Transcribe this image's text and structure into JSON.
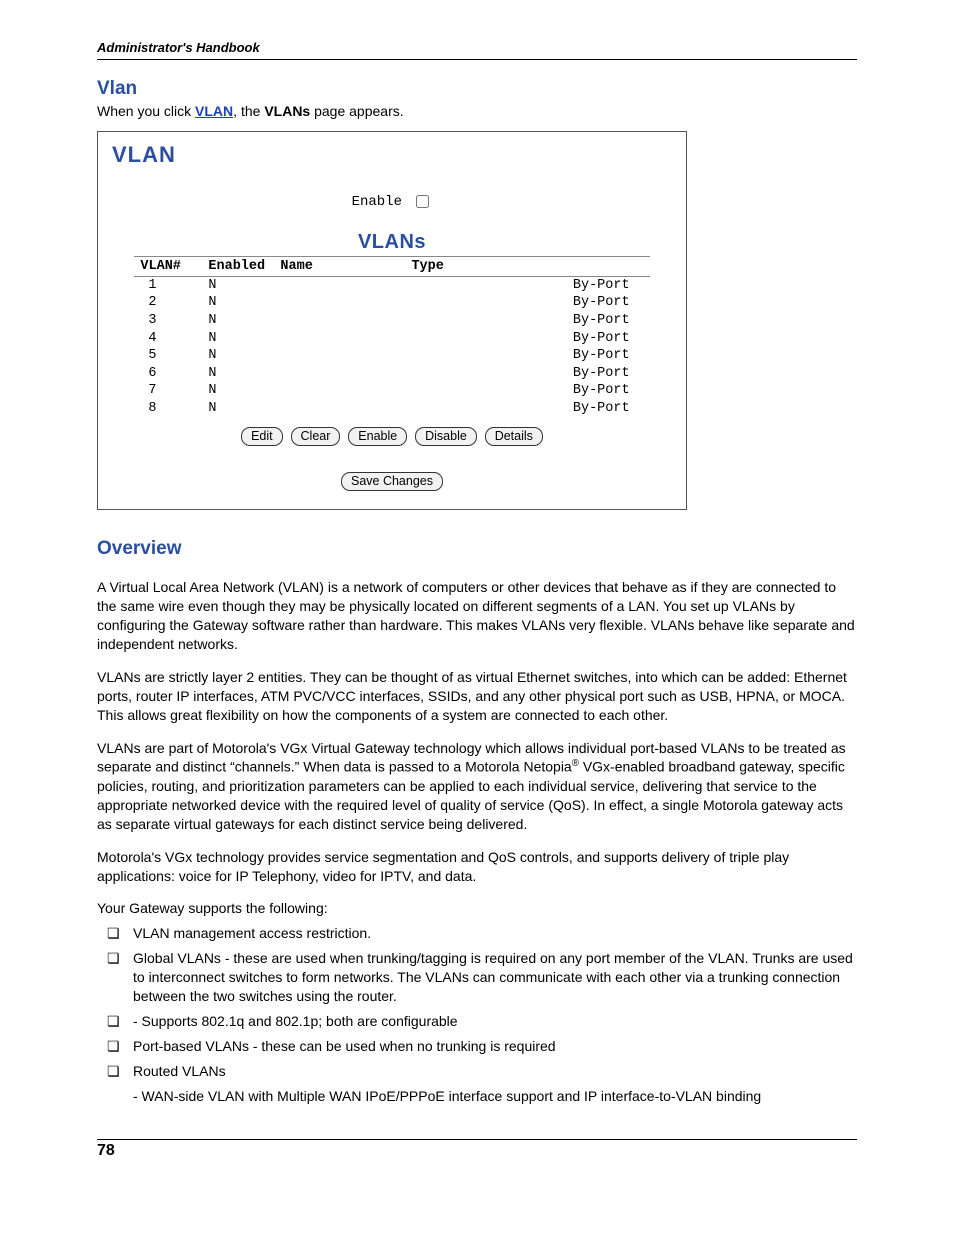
{
  "header": {
    "running": "Administrator's Handbook"
  },
  "section1": {
    "title": "Vlan",
    "intro_pre": "When you click ",
    "intro_link": "VLAN",
    "intro_mid": ", the ",
    "intro_bold": "VLANs",
    "intro_post": " page appears."
  },
  "panel": {
    "title": "VLAN",
    "enable_label": "Enable",
    "subtitle": "VLANs",
    "cols": {
      "vlan": "VLAN#",
      "enabled": "Enabled",
      "name": "Name",
      "type": "Type"
    },
    "rows": [
      {
        "n": "1",
        "en": "N",
        "name": "",
        "type": "By-Port"
      },
      {
        "n": "2",
        "en": "N",
        "name": "",
        "type": "By-Port"
      },
      {
        "n": "3",
        "en": "N",
        "name": "",
        "type": "By-Port"
      },
      {
        "n": "4",
        "en": "N",
        "name": "",
        "type": "By-Port"
      },
      {
        "n": "5",
        "en": "N",
        "name": "",
        "type": "By-Port"
      },
      {
        "n": "6",
        "en": "N",
        "name": "",
        "type": "By-Port"
      },
      {
        "n": "7",
        "en": "N",
        "name": "",
        "type": "By-Port"
      },
      {
        "n": "8",
        "en": "N",
        "name": "",
        "type": "By-Port"
      }
    ],
    "buttons": {
      "edit": "Edit",
      "clear": "Clear",
      "enable": "Enable",
      "disable": "Disable",
      "details": "Details",
      "save": "Save Changes"
    }
  },
  "overview": {
    "title": "Overview",
    "p1": "A Virtual Local Area Network (VLAN) is a network of computers or other devices that behave as if they are connected to the same wire even though they may be physically located on different segments of a LAN. You set up VLANs by configuring the Gateway software rather than hardware. This makes VLANs very flexible. VLANs behave like separate and independent networks.",
    "p2": "VLANs are strictly layer 2 entities. They can be thought of as virtual Ethernet switches, into which can be added: Ethernet ports, router IP interfaces, ATM PVC/VCC interfaces, SSIDs, and any other physical port such as USB, HPNA, or MOCA. This allows great flexibility on how the components of a system are connected to each other.",
    "p3a": "VLANs are part of Motorola's VGx Virtual Gateway technology which allows individual port-based VLANs to be treated as separate and distinct “channels.” When data is passed to a Motorola Netopia",
    "p3b": " VGx-enabled broadband gateway, specific policies, routing, and prioritization parameters can be applied to each individual service, delivering that service to the appropriate networked device with the required level of quality of service (QoS). In effect, a single Motorola gateway acts as separate virtual gateways for each distinct service being delivered.",
    "p4": "Motorola's VGx technology provides service segmentation and QoS controls, and supports delivery of triple play applications: voice for IP Telephony, video for IPTV, and data.",
    "p5": "Your Gateway supports the following:",
    "bullets": [
      "VLAN management access restriction.",
      "Global VLANs - these are used when trunking/tagging is required on any port member of the VLAN. Trunks are used to interconnect switches to form networks. The VLANs can communicate with each other via a trunking connection between the two switches using the router.",
      " - Supports 802.1q and 802.1p; both are configurable",
      "Port-based VLANs - these can be used when no trunking is required",
      "Routed VLANs"
    ],
    "sub_routed": " - WAN-side VLAN with Multiple WAN IPoE/PPPoE interface support and IP interface-to-VLAN binding"
  },
  "footer": {
    "page": "78"
  }
}
